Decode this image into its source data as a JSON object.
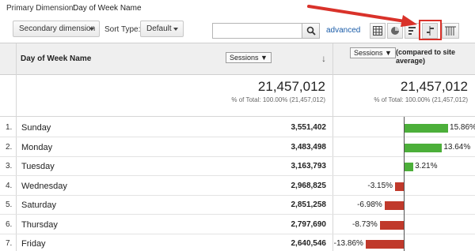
{
  "primary_dimension": {
    "label": "Primary Dimension:",
    "value": "Day of Week Name"
  },
  "toolbar": {
    "secondary_dimension": "Secondary dimension",
    "sort_type_label": "Sort Type:",
    "sort_type_value": "Default",
    "search_placeholder": "",
    "advanced": "advanced"
  },
  "view_buttons": [
    "table-icon",
    "pie-icon",
    "performance-icon",
    "comparison-icon",
    "pivot-icon"
  ],
  "active_view": "comparison-icon",
  "table": {
    "dimension_header": "Day of Week Name",
    "metric_select": "Sessions ▼",
    "compare_select": "Sessions ▼",
    "compare_text": "(compared to site average)",
    "totals": {
      "sessions": "21,457,012",
      "sessions_pct": "% of Total: 100.00% (21,457,012)",
      "compare": "21,457,012",
      "compare_pct": "% of Total: 100.00% (21,457,012)"
    },
    "rows": [
      {
        "num": "1.",
        "day": "Sunday",
        "sessions": "3,551,402",
        "pct_label": "15.86%",
        "pct": 15.86
      },
      {
        "num": "2.",
        "day": "Monday",
        "sessions": "3,483,498",
        "pct_label": "13.64%",
        "pct": 13.64
      },
      {
        "num": "3.",
        "day": "Tuesday",
        "sessions": "3,163,793",
        "pct_label": "3.21%",
        "pct": 3.21
      },
      {
        "num": "4.",
        "day": "Wednesday",
        "sessions": "2,968,825",
        "pct_label": "-3.15%",
        "pct": -3.15
      },
      {
        "num": "5.",
        "day": "Saturday",
        "sessions": "2,851,258",
        "pct_label": "-6.98%",
        "pct": -6.98
      },
      {
        "num": "6.",
        "day": "Thursday",
        "sessions": "2,797,690",
        "pct_label": "-8.73%",
        "pct": -8.73
      },
      {
        "num": "7.",
        "day": "Friday",
        "sessions": "2,640,546",
        "pct_label": "-13.86%",
        "pct": -13.86
      }
    ]
  },
  "colors": {
    "positive": "#4caf3a",
    "negative": "#c0392b",
    "highlight": "#d9322a",
    "link": "#1a5ca8"
  }
}
